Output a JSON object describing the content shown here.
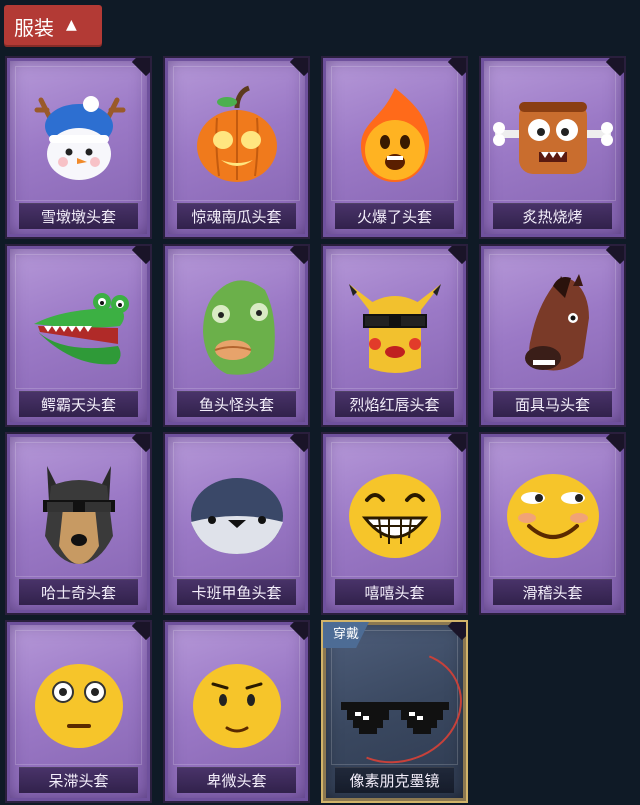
{
  "header": {
    "title": "服装"
  },
  "items": [
    {
      "label": "雪墩墩头套",
      "icon": "snowman-reindeer-hat-icon",
      "equipped": false
    },
    {
      "label": "惊魂南瓜头套",
      "icon": "pumpkin-head-icon",
      "equipped": false
    },
    {
      "label": "火爆了头套",
      "icon": "fireball-head-icon",
      "equipped": false
    },
    {
      "label": "炙热烧烤",
      "icon": "bbq-meat-head-icon",
      "equipped": false
    },
    {
      "label": "鳄霸天头套",
      "icon": "crocodile-head-icon",
      "equipped": false
    },
    {
      "label": "鱼头怪头套",
      "icon": "fish-head-icon",
      "equipped": false
    },
    {
      "label": "烈焰红唇头套",
      "icon": "yellow-mask-sunglasses-icon",
      "equipped": false
    },
    {
      "label": "面具马头套",
      "icon": "horse-head-icon",
      "equipped": false
    },
    {
      "label": "哈士奇头套",
      "icon": "husky-head-icon",
      "equipped": false
    },
    {
      "label": "卡班甲鱼头套",
      "icon": "turtle-head-icon",
      "equipped": false
    },
    {
      "label": "嘻嘻头套",
      "icon": "grin-emoji-head-icon",
      "equipped": false
    },
    {
      "label": "滑稽头套",
      "icon": "funny-emoji-head-icon",
      "equipped": false
    },
    {
      "label": "呆滞头套",
      "icon": "stunned-emoji-head-icon",
      "equipped": false
    },
    {
      "label": "卑微头套",
      "icon": "humble-emoji-head-icon",
      "equipped": false
    },
    {
      "label": "像素朋克墨镜",
      "icon": "pixel-sunglasses-icon",
      "equipped": true,
      "badge": "穿戴"
    }
  ]
}
